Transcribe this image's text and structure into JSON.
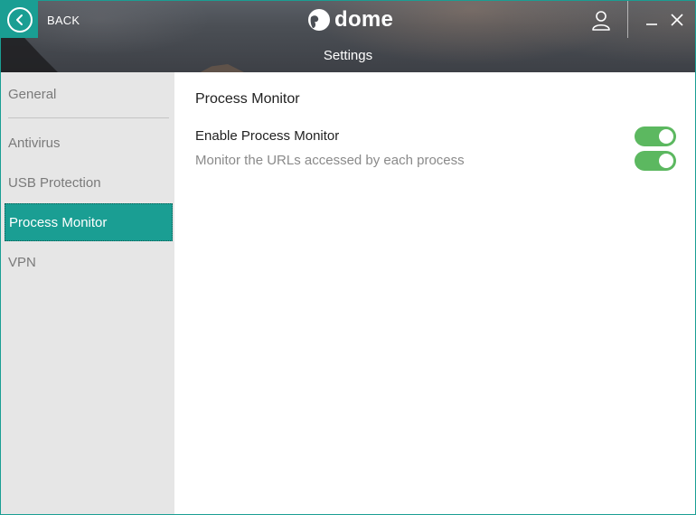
{
  "header": {
    "back_label": "BACK",
    "logo_text": "dome",
    "subtitle": "Settings"
  },
  "sidebar": {
    "items": [
      {
        "label": "General",
        "active": false
      },
      {
        "label": "Antivirus",
        "active": false
      },
      {
        "label": "USB Protection",
        "active": false
      },
      {
        "label": "Process Monitor",
        "active": true
      },
      {
        "label": "VPN",
        "active": false
      }
    ]
  },
  "main": {
    "title": "Process Monitor",
    "settings": [
      {
        "label": "Enable Process Monitor",
        "enabled": true
      },
      {
        "label": "Monitor the URLs accessed by each process",
        "enabled": true
      }
    ]
  },
  "colors": {
    "accent": "#1a9e93",
    "toggle_on": "#5cb860",
    "sidebar_bg": "#e6e6e6"
  },
  "icons": [
    "back-arrow-icon",
    "dome-logo-icon",
    "user-icon",
    "minimize-icon",
    "close-icon"
  ]
}
